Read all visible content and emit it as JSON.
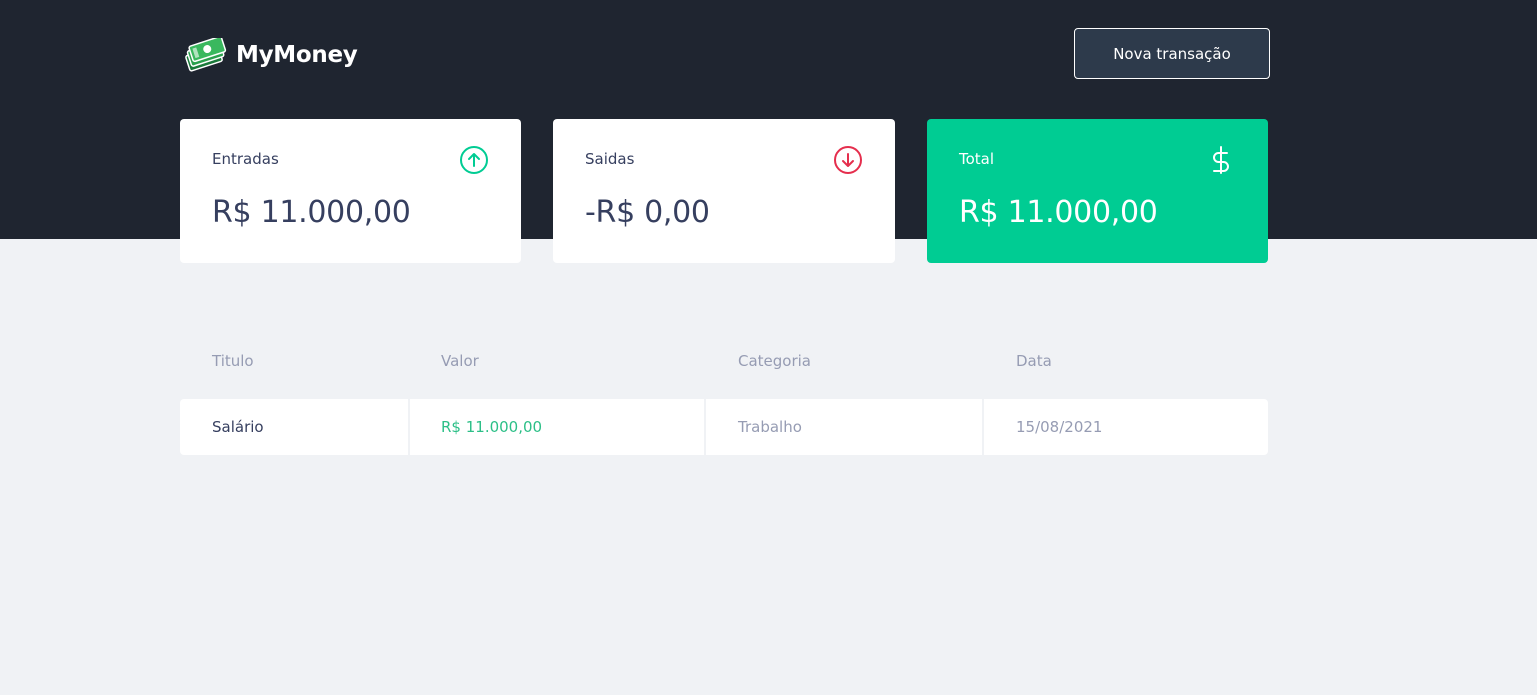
{
  "app": {
    "name": "MyMoney",
    "logo_icon": "money-stack-icon"
  },
  "header": {
    "new_transaction_label": "Nova transação"
  },
  "summary": {
    "income": {
      "label": "Entradas",
      "value": "R$ 11.000,00",
      "icon": "arrow-up-circle-icon",
      "color": "#00cc93"
    },
    "outcome": {
      "label": "Saidas",
      "value": "-R$ 0,00",
      "icon": "arrow-down-circle-icon",
      "color": "#e52e4d"
    },
    "total": {
      "label": "Total",
      "value": "R$ 11.000,00",
      "icon": "dollar-sign-icon",
      "color": "#00cc93"
    }
  },
  "table": {
    "columns": [
      "Titulo",
      "Valor",
      "Categoria",
      "Data"
    ],
    "rows": [
      {
        "title": "Salário",
        "amount": "R$ 11.000,00",
        "category": "Trabalho",
        "date": "15/08/2021"
      }
    ]
  },
  "colors": {
    "header_bg": "#1f2530",
    "page_bg": "#f0f2f5",
    "accent_green": "#00cc93",
    "accent_red": "#e52e4d",
    "text_dark": "#363f5f",
    "text_muted": "#969cb3"
  }
}
